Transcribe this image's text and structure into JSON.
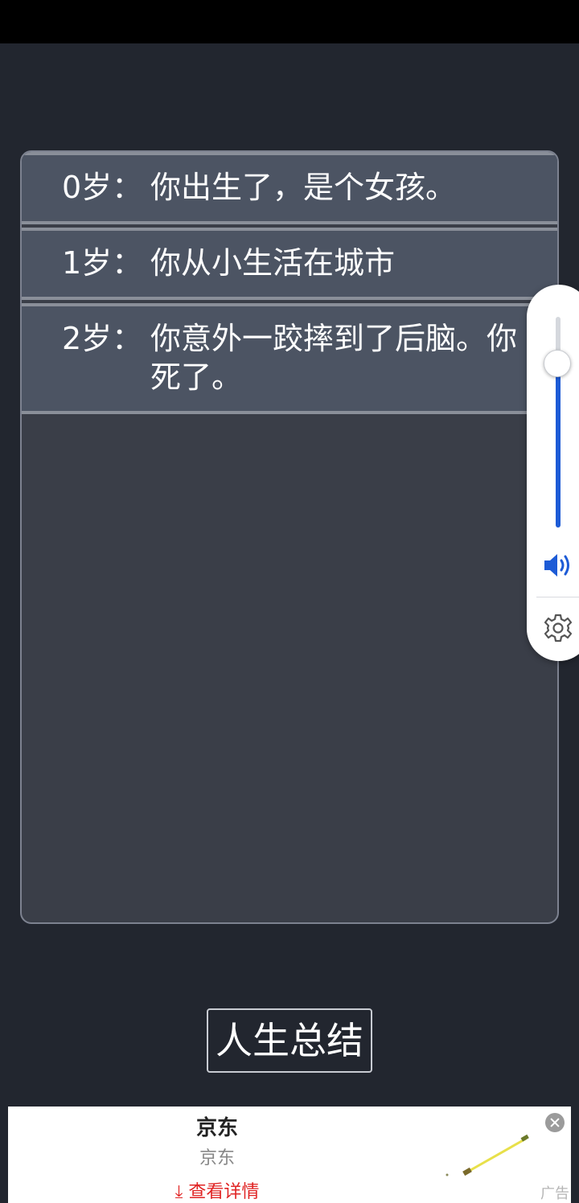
{
  "life_log": {
    "entries": [
      {
        "age": "0岁：",
        "text": "你出生了，是个女孩。"
      },
      {
        "age": "1岁：",
        "text": "你从小生活在城市"
      },
      {
        "age": "2岁：",
        "text": "你意外一跤摔到了后脑。你死了。"
      }
    ]
  },
  "summary_button": {
    "label": "人生总结"
  },
  "volume": {
    "level": 0.78,
    "accent": "#1d5bd6",
    "speaker_icon": "speaker-icon",
    "settings_icon": "gear-icon"
  },
  "ad": {
    "title": "京东",
    "subtitle": "京东",
    "cta": "⤓ 查看详情",
    "tag": "广告",
    "cta_color": "#e02424"
  }
}
